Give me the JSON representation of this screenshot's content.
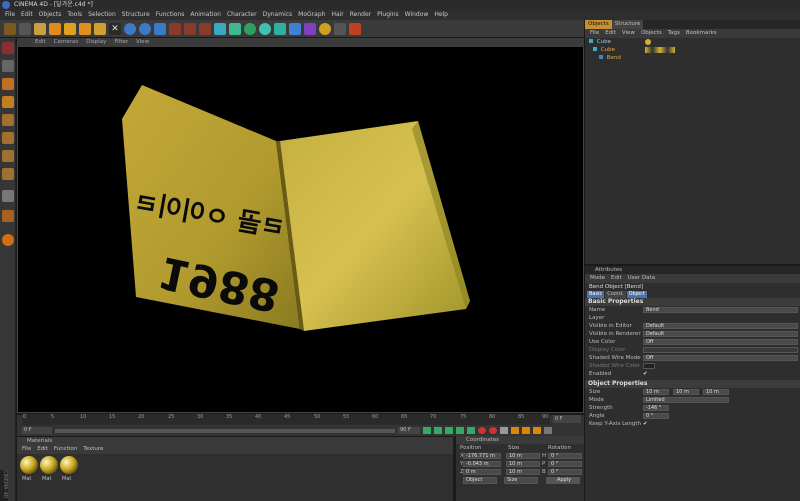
{
  "window": {
    "title": "CINEMA 4D - [달가운.c4d *]"
  },
  "menu": [
    "File",
    "Edit",
    "Objects",
    "Tools",
    "Selection",
    "Structure",
    "Functions",
    "Animation",
    "Character",
    "Dynamics",
    "MoGraph",
    "Hair",
    "Render",
    "Plugins",
    "Window",
    "Help"
  ],
  "viewport": {
    "menu": [
      "Edit",
      "Cameras",
      "Display",
      "Filter",
      "View"
    ],
    "book_text_top": "ㄹ골 ㅇ이이ㄹ",
    "book_text_number": "1988"
  },
  "timeline": {
    "ticks": [
      "0",
      "5",
      "10",
      "15",
      "20",
      "25",
      "30",
      "35",
      "40",
      "45",
      "50",
      "55",
      "60",
      "65",
      "70",
      "75",
      "80",
      "85",
      "90"
    ],
    "current_frame": "0 F",
    "start": "0 F",
    "end": "90 F",
    "end_display": "0 F"
  },
  "materials": {
    "title": "Materials",
    "menu": [
      "File",
      "Edit",
      "Function",
      "Texture"
    ],
    "items": [
      "Mat",
      "Mat",
      "Mat"
    ]
  },
  "coordinates": {
    "title": "Coordinates",
    "headers": [
      "Position",
      "Size",
      "Rotation"
    ],
    "rows": [
      {
        "axis": "X",
        "pos": "-176.771 m",
        "size": "10 m",
        "rlabel": "H",
        "rot": "0 °"
      },
      {
        "axis": "Y",
        "pos": "-0.043 m",
        "size": "10 m",
        "rlabel": "P",
        "rot": "0 °"
      },
      {
        "axis": "Z",
        "pos": "0 m",
        "size": "10 m",
        "rlabel": "B",
        "rot": "0 °"
      }
    ],
    "mode": "Object",
    "sizemode": "Size",
    "apply": "Apply"
  },
  "objects": {
    "tabs": [
      "Objects",
      "Structure"
    ],
    "menu": [
      "File",
      "Edit",
      "View",
      "Objects",
      "Tags",
      "Bookmarks"
    ],
    "items": [
      {
        "name": "Cube",
        "color": "#9ec4e8"
      },
      {
        "name": "Cube",
        "color": "#e8a64a"
      },
      {
        "name": "Bend",
        "color": "#e8a64a"
      }
    ]
  },
  "attributes": {
    "title": "Attributes",
    "menu": [
      "Mode",
      "Edit",
      "User Data"
    ],
    "object": "Bend Object [Bend]",
    "tabs": [
      "Basic",
      "Coord.",
      "Object"
    ],
    "basic_title": "Basic Properties",
    "basic": [
      {
        "label": "Name",
        "value": "Bend"
      },
      {
        "label": "Layer",
        "value": ""
      },
      {
        "label": "Visible in Editor",
        "value": "Default"
      },
      {
        "label": "Visible in Renderer",
        "value": "Default"
      },
      {
        "label": "Use Color",
        "value": "Off"
      },
      {
        "label": "Display Color",
        "value": ""
      },
      {
        "label": "Shaded Wire Mode",
        "value": "Off"
      },
      {
        "label": "Shaded Wire Color",
        "value": ""
      },
      {
        "label": "Enabled",
        "value": "✔"
      }
    ],
    "object_title": "Object Properties",
    "size": [
      "10 m",
      "10 m",
      "10 m"
    ],
    "mode": "Limited",
    "strength": "-146 °",
    "angle": "0 °",
    "keep_label": "Keep Y-Axis Length",
    "keep_value": "✔",
    "labels": {
      "size": "Size",
      "mode": "Mode",
      "strength": "Strength",
      "angle": "Angle"
    }
  },
  "colors": {
    "accent": "#e8a64a",
    "book": "#b8a030"
  }
}
